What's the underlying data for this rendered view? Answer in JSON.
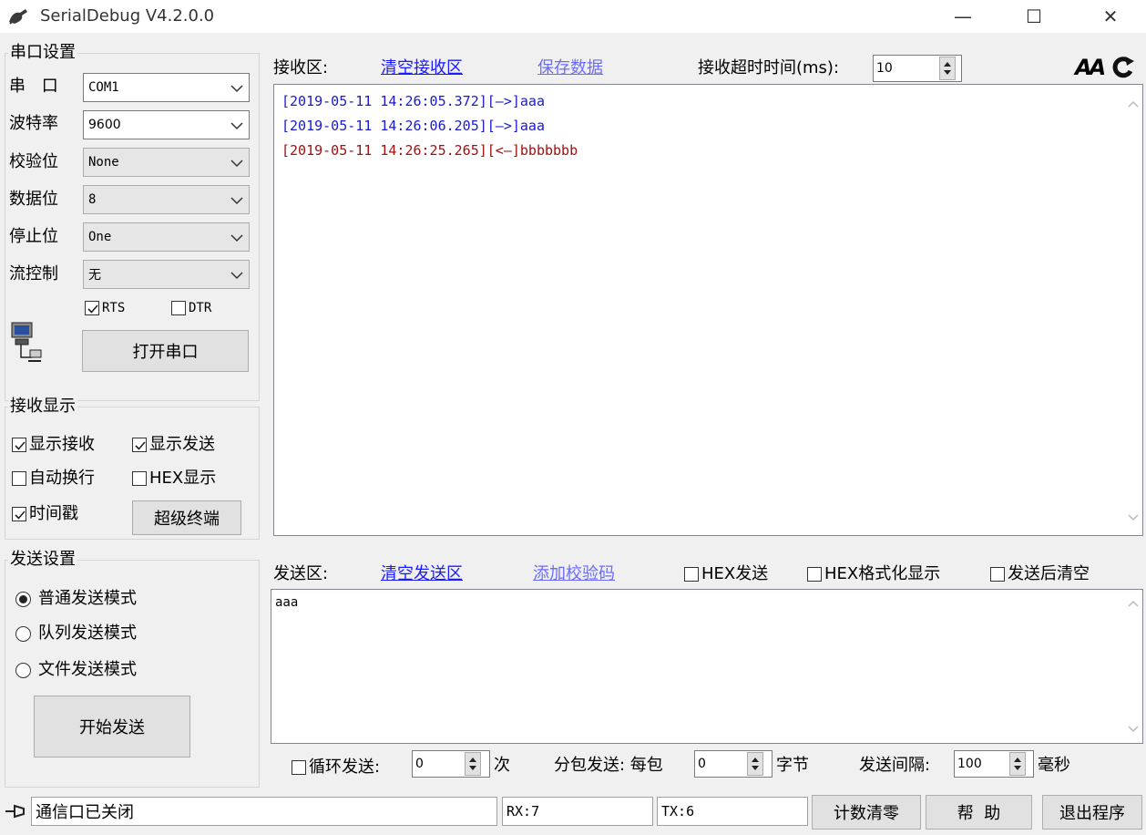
{
  "window": {
    "title": "SerialDebug V4.2.0.0",
    "minimize": "—",
    "maximize": "☐",
    "close": "✕"
  },
  "serial": {
    "group_title": "串口设置",
    "port_label": "串 口",
    "port_value": "COM1",
    "baud_label": "波特率",
    "baud_value": "9600",
    "parity_label": "校验位",
    "parity_value": "None",
    "databits_label": "数据位",
    "databits_value": "8",
    "stopbits_label": "停止位",
    "stopbits_value": "One",
    "flow_label": "流控制",
    "flow_value": "无",
    "rts_label": "RTS",
    "rts_checked": true,
    "dtr_label": "DTR",
    "dtr_checked": false,
    "open_button": "打开串口"
  },
  "recv_display": {
    "group_title": "接收显示",
    "show_recv": "显示接收",
    "show_recv_checked": true,
    "show_send": "显示发送",
    "show_send_checked": true,
    "auto_wrap": "自动换行",
    "auto_wrap_checked": false,
    "hex_display": "HEX显示",
    "hex_display_checked": false,
    "timestamp": "时间戳",
    "timestamp_checked": true,
    "terminal_button": "超级终端"
  },
  "send_settings": {
    "group_title": "发送设置",
    "modes": [
      "普通发送模式",
      "队列发送模式",
      "文件发送模式"
    ],
    "selected_mode": 0,
    "start_button": "开始发送"
  },
  "receive": {
    "label": "接收区:",
    "clear_link": "清空接收区",
    "save_link": "保存数据",
    "timeout_label": "接收超时时间(ms):",
    "timeout_value": "10",
    "lines": [
      {
        "text": "[2019-05-11 14:26:05.372][—>]aaa",
        "color": "#1a1acc"
      },
      {
        "text": "[2019-05-11 14:26:06.205][—>]aaa",
        "color": "#1a1acc"
      },
      {
        "text": "[2019-05-11 14:26:25.265][<—]bbbbbbb",
        "color": "#a01010"
      }
    ]
  },
  "send": {
    "label": "发送区:",
    "clear_link": "清空发送区",
    "checksum_link": "添加校验码",
    "hex_send": "HEX发送",
    "hex_send_checked": false,
    "hex_format": "HEX格式化显示",
    "hex_format_checked": false,
    "clear_after": "发送后清空",
    "clear_after_checked": false,
    "content": "aaa",
    "loop_label": "循环发送:",
    "loop_value": "0",
    "loop_unit": "次",
    "loop_checked": false,
    "packet_label": "分包发送: 每包",
    "packet_value": "0",
    "packet_unit": "字节",
    "interval_label": "发送间隔:",
    "interval_value": "100",
    "interval_unit": "毫秒"
  },
  "status": {
    "port_status": "通信口已关闭",
    "rx": "RX:7",
    "tx": "TX:6",
    "reset_button": "计数清零",
    "help_button": "帮  助",
    "exit_button": "退出程序"
  }
}
